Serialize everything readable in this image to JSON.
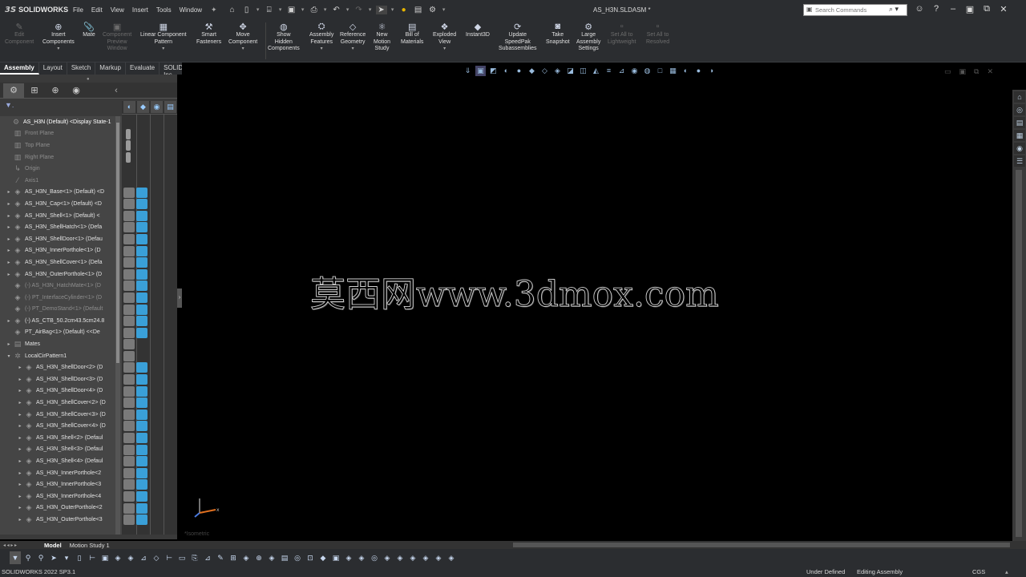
{
  "app": {
    "brand": "SOLIDWORKS",
    "brand_mark": "3S"
  },
  "menu": [
    "File",
    "Edit",
    "View",
    "Insert",
    "Tools",
    "Window"
  ],
  "window_title": "AS_H3N.SLDASM *",
  "search": {
    "placeholder": "Search Commands"
  },
  "commands": [
    {
      "label": "Edit\nComponent",
      "disabled": true
    },
    {
      "label": "Insert\nComponents",
      "disabled": false
    },
    {
      "label": "Mate",
      "disabled": false
    },
    {
      "label": "Component\nPreview\nWindow",
      "disabled": true
    },
    {
      "label": "Linear Component\nPattern",
      "disabled": false
    },
    {
      "label": "Smart\nFasteners",
      "disabled": false
    },
    {
      "label": "Move\nComponent",
      "disabled": false
    },
    {
      "label": "Show\nHidden\nComponents",
      "disabled": false
    },
    {
      "label": "Assembly\nFeatures",
      "disabled": false
    },
    {
      "label": "Reference\nGeometry",
      "disabled": false
    },
    {
      "label": "New\nMotion\nStudy",
      "disabled": false
    },
    {
      "label": "Bill of\nMaterials",
      "disabled": false
    },
    {
      "label": "Exploded\nView",
      "disabled": false
    },
    {
      "label": "Instant3D",
      "disabled": false
    },
    {
      "label": "Update\nSpeedPak\nSubassemblies",
      "disabled": false
    },
    {
      "label": "Take\nSnapshot",
      "disabled": false
    },
    {
      "label": "Large\nAssembly\nSettings",
      "disabled": false
    },
    {
      "label": "Set All to\nLightweight",
      "disabled": true
    },
    {
      "label": "Set All to\nResolved",
      "disabled": true
    }
  ],
  "tabs": [
    "Assembly",
    "Layout",
    "Sketch",
    "Markup",
    "Evaluate",
    "SOLIDWORKS Add-Ins"
  ],
  "tree": [
    {
      "label": "AS_H3N (Default) <Display State-1",
      "icon": "assembly-icon",
      "level": 0,
      "arrow": "",
      "style": "hl"
    },
    {
      "label": "Front Plane",
      "icon": "plane-icon",
      "level": 1,
      "arrow": "",
      "style": "dim"
    },
    {
      "label": "Top Plane",
      "icon": "plane-icon",
      "level": 1,
      "arrow": "",
      "style": "dim"
    },
    {
      "label": "Right Plane",
      "icon": "plane-icon",
      "level": 1,
      "arrow": "",
      "style": "dim"
    },
    {
      "label": "Origin",
      "icon": "origin-icon",
      "level": 1,
      "arrow": "",
      "style": "dim"
    },
    {
      "label": "Axis1",
      "icon": "axis-icon",
      "level": 1,
      "arrow": "",
      "style": "dim"
    },
    {
      "label": "AS_H3N_Base<1> (Default) <D",
      "icon": "part-icon",
      "level": 1,
      "arrow": "▸",
      "style": ""
    },
    {
      "label": "AS_H3N_Cap<1> (Default) <D",
      "icon": "part-icon",
      "level": 1,
      "arrow": "▸",
      "style": ""
    },
    {
      "label": "AS_H3N_Shell<1> (Default) <",
      "icon": "part-icon",
      "level": 1,
      "arrow": "▸",
      "style": ""
    },
    {
      "label": "AS_H3N_ShellHatch<1> (Defa",
      "icon": "part-icon",
      "level": 1,
      "arrow": "▸",
      "style": ""
    },
    {
      "label": "AS_H3N_ShellDoor<1> (Defau",
      "icon": "part-icon",
      "level": 1,
      "arrow": "▸",
      "style": ""
    },
    {
      "label": "AS_H3N_InnerPorthole<1> (D",
      "icon": "part-icon",
      "level": 1,
      "arrow": "▸",
      "style": ""
    },
    {
      "label": "AS_H3N_ShellCover<1> (Defa",
      "icon": "part-icon",
      "level": 1,
      "arrow": "▸",
      "style": ""
    },
    {
      "label": "AS_H3N_OuterPorthole<1> (D",
      "icon": "part-icon",
      "level": 1,
      "arrow": "▸",
      "style": ""
    },
    {
      "label": "(-) AS_H3N_HatchMate<1> (D",
      "icon": "part-icon",
      "level": 1,
      "arrow": "",
      "style": "dim"
    },
    {
      "label": "(-) PT_InterfaceCylinder<1> (D",
      "icon": "part-icon",
      "level": 1,
      "arrow": "",
      "style": "dim"
    },
    {
      "label": "(-) PT_DemoStand<1> (Default",
      "icon": "part-icon",
      "level": 1,
      "arrow": "",
      "style": "dim"
    },
    {
      "label": "(-) AS_CTB_50.2cm43.5cm24.8",
      "icon": "part-icon",
      "level": 1,
      "arrow": "▸",
      "style": ""
    },
    {
      "label": "PT_AirBag<1> (Default) <<De",
      "icon": "part-icon",
      "level": 1,
      "arrow": "",
      "style": ""
    },
    {
      "label": "Mates",
      "icon": "mates-icon",
      "level": 1,
      "arrow": "▸",
      "style": ""
    },
    {
      "label": "LocalCirPattern1",
      "icon": "pattern-icon",
      "level": 1,
      "arrow": "▾",
      "style": ""
    },
    {
      "label": "AS_H3N_ShellDoor<2> (D",
      "icon": "part-icon",
      "level": 2,
      "arrow": "▸",
      "style": ""
    },
    {
      "label": "AS_H3N_ShellDoor<3> (D",
      "icon": "part-icon",
      "level": 2,
      "arrow": "▸",
      "style": ""
    },
    {
      "label": "AS_H3N_ShellDoor<4> (D",
      "icon": "part-icon",
      "level": 2,
      "arrow": "▸",
      "style": ""
    },
    {
      "label": "AS_H3N_ShellCover<2> (D",
      "icon": "part-icon",
      "level": 2,
      "arrow": "▸",
      "style": ""
    },
    {
      "label": "AS_H3N_ShellCover<3> (D",
      "icon": "part-icon",
      "level": 2,
      "arrow": "▸",
      "style": ""
    },
    {
      "label": "AS_H3N_ShellCover<4> (D",
      "icon": "part-icon",
      "level": 2,
      "arrow": "▸",
      "style": ""
    },
    {
      "label": "AS_H3N_Shell<2> (Defaul",
      "icon": "part-icon",
      "level": 2,
      "arrow": "▸",
      "style": ""
    },
    {
      "label": "AS_H3N_Shell<3> (Defaul",
      "icon": "part-icon",
      "level": 2,
      "arrow": "▸",
      "style": ""
    },
    {
      "label": "AS_H3N_Shell<4> (Defaul",
      "icon": "part-icon",
      "level": 2,
      "arrow": "▸",
      "style": ""
    },
    {
      "label": "AS_H3N_InnerPorthole<2",
      "icon": "part-icon",
      "level": 2,
      "arrow": "▸",
      "style": ""
    },
    {
      "label": "AS_H3N_InnerPorthole<3",
      "icon": "part-icon",
      "level": 2,
      "arrow": "▸",
      "style": ""
    },
    {
      "label": "AS_H3N_InnerPorthole<4",
      "icon": "part-icon",
      "level": 2,
      "arrow": "▸",
      "style": ""
    },
    {
      "label": "AS_H3N_OuterPorthole<2",
      "icon": "part-icon",
      "level": 2,
      "arrow": "▸",
      "style": ""
    },
    {
      "label": "AS_H3N_OuterPorthole<3",
      "icon": "part-icon",
      "level": 2,
      "arrow": "▸",
      "style": ""
    }
  ],
  "watermark": "莫西网www.3dmox.com",
  "viewport_label": "*Isometric",
  "bottom_tabs": [
    "Model",
    "Motion Study 1"
  ],
  "status": {
    "version": "SOLIDWORKS 2022 SP3.1",
    "definition": "Under Defined",
    "mode": "Editing Assembly",
    "units": "CGS"
  },
  "colors": {
    "background": "#2b2d30",
    "viewport": "#000000",
    "accent": "#3aa0d8"
  }
}
